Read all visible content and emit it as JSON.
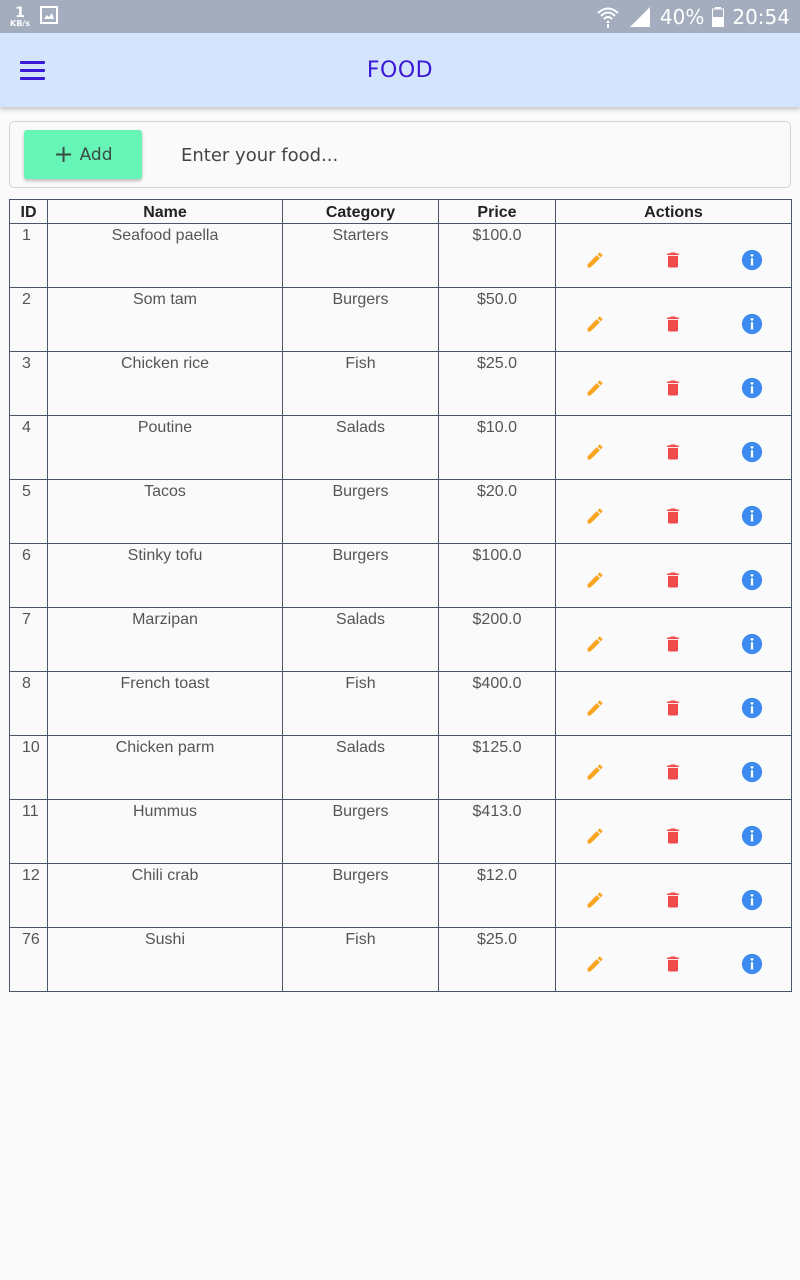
{
  "status_bar": {
    "speed_value": "1",
    "speed_unit": "KB/s",
    "battery_text": "40%",
    "time": "20:54"
  },
  "appbar": {
    "title": "FOOD",
    "menu_icon": "hamburger-menu-icon"
  },
  "add_form": {
    "add_button_label": "Add",
    "add_icon": "plus-icon",
    "input_placeholder": "Enter your food...",
    "input_value": ""
  },
  "table": {
    "headers": [
      "ID",
      "Name",
      "Category",
      "Price",
      "Actions"
    ],
    "rows": [
      {
        "id": "1",
        "name": "Seafood paella",
        "category": "Starters",
        "price": "$100.0"
      },
      {
        "id": "2",
        "name": "Som tam",
        "category": "Burgers",
        "price": "$50.0"
      },
      {
        "id": "3",
        "name": "Chicken rice",
        "category": "Fish",
        "price": "$25.0"
      },
      {
        "id": "4",
        "name": "Poutine",
        "category": "Salads",
        "price": "$10.0"
      },
      {
        "id": "5",
        "name": "Tacos",
        "category": "Burgers",
        "price": "$20.0"
      },
      {
        "id": "6",
        "name": "Stinky tofu",
        "category": "Burgers",
        "price": "$100.0"
      },
      {
        "id": "7",
        "name": "Marzipan",
        "category": "Salads",
        "price": "$200.0"
      },
      {
        "id": "8",
        "name": "French toast",
        "category": "Fish",
        "price": "$400.0"
      },
      {
        "id": "10",
        "name": "Chicken parm",
        "category": "Salads",
        "price": "$125.0"
      },
      {
        "id": "11",
        "name": "Hummus",
        "category": "Burgers",
        "price": "$413.0"
      },
      {
        "id": "12",
        "name": "Chili crab",
        "category": "Burgers",
        "price": "$12.0"
      },
      {
        "id": "76",
        "name": "Sushi",
        "category": "Fish",
        "price": "$25.0"
      }
    ],
    "row_actions": [
      "edit-pencil-icon",
      "delete-trash-icon",
      "info-icon"
    ]
  },
  "colors": {
    "status_bar": "#a3adbd",
    "appbar_bg": "#d4e4fc",
    "accent": "#3a18d6",
    "add_button": "#66f5b6",
    "edit": "#f6a623",
    "delete": "#ef4b4b",
    "info": "#3d8bf0"
  }
}
